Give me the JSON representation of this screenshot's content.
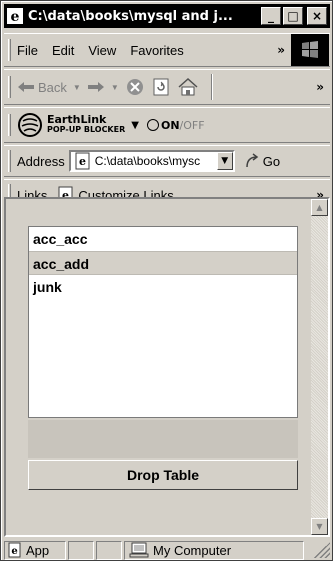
{
  "window": {
    "title": "C:\\data\\books\\mysql and j...",
    "minimize_label": "_",
    "maximize_label": "□",
    "close_label": "×"
  },
  "menubar": {
    "items": [
      "File",
      "Edit",
      "View",
      "Favorites"
    ],
    "more": "»"
  },
  "navbar": {
    "back_label": "Back",
    "more": "»"
  },
  "popupbar": {
    "brand_line1": "EarthLink",
    "brand_line2": "POP-UP BLOCKER",
    "on_label": "ON",
    "off_label": "/OFF"
  },
  "addressbar": {
    "label": "Address",
    "value": "C:\\data\\books\\mysc",
    "go_label": "Go"
  },
  "linksbar": {
    "label": "Links",
    "item": "Customize Links",
    "more": "»"
  },
  "content": {
    "tables": [
      "acc_acc",
      "acc_add",
      "junk"
    ],
    "selected_index": 1,
    "drop_button_label": "Drop Table"
  },
  "statusbar": {
    "app_label": "App",
    "zone_label": "My Computer"
  },
  "colors": {
    "face": "#d4d0c8",
    "titlebar": "#000000",
    "selection": "#d4d0c8"
  }
}
